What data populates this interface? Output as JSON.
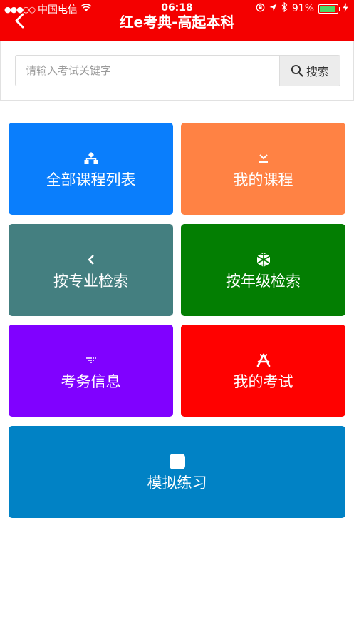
{
  "status_bar": {
    "carrier": "中国电信",
    "time": "06:18",
    "battery": "91%"
  },
  "header": {
    "title": "红e考典-高起本科"
  },
  "search": {
    "placeholder": "请输入考试关键字",
    "button_label": "搜索"
  },
  "tiles": [
    {
      "label": "全部课程列表",
      "color": "#0a7efc",
      "icon": "sitemap-icon"
    },
    {
      "label": "我的课程",
      "color": "#ff8244",
      "icon": "download-icon"
    },
    {
      "label": "按专业检索",
      "color": "#447f80",
      "icon": "chevron-left-icon"
    },
    {
      "label": "按年级检索",
      "color": "#037e02",
      "icon": "cubes-icon"
    },
    {
      "label": "考务信息",
      "color": "#8001ff",
      "icon": "dots-icon"
    },
    {
      "label": "我的考试",
      "color": "#ff0100",
      "icon": "app-store-icon"
    },
    {
      "label": "模拟练习",
      "color": "#0182c5",
      "icon": "square-icon"
    }
  ]
}
